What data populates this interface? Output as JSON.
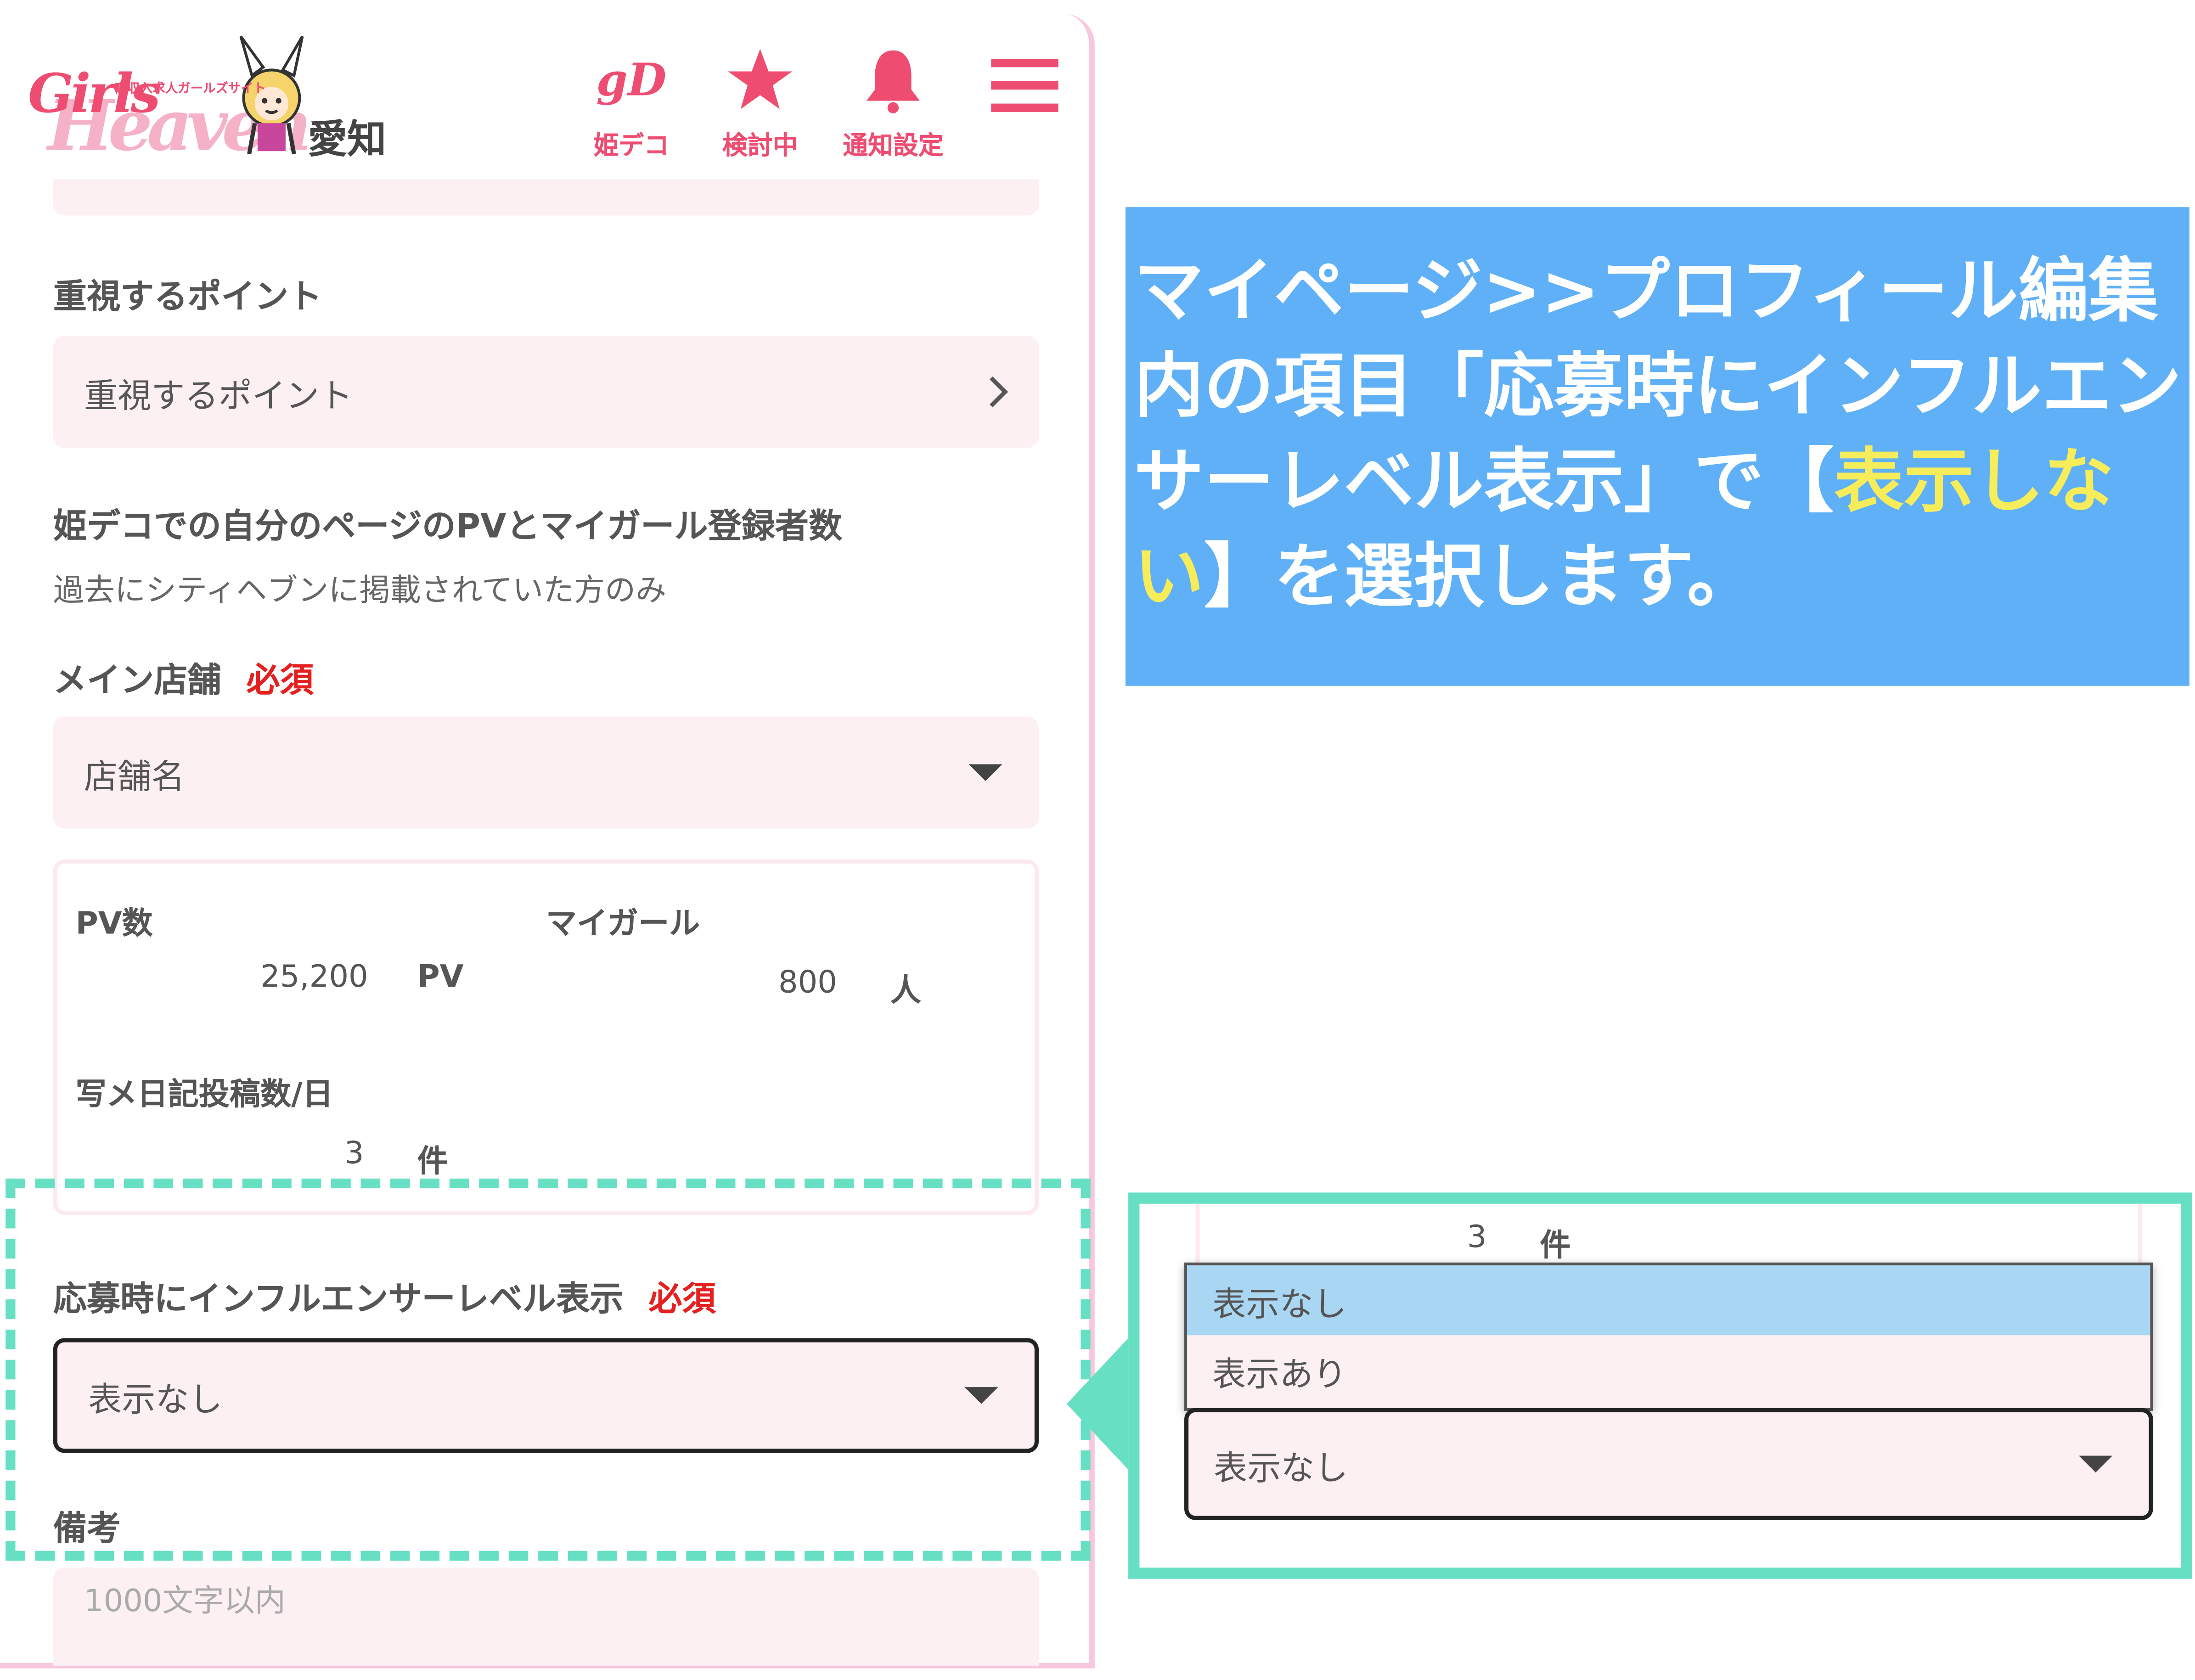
{
  "header": {
    "logo_girls": "Girls",
    "logo_heaven": "Heaven",
    "logo_tagline": "高収入求人ガールズサイト",
    "logo_area": "愛知",
    "nav": [
      {
        "label": "姫デコ",
        "icon": "himedeco-icon"
      },
      {
        "label": "検討中",
        "icon": "star-icon"
      },
      {
        "label": "通知設定",
        "icon": "bell-icon"
      }
    ],
    "menu_icon": "hamburger-icon"
  },
  "form": {
    "priority_label": "重視するポイント",
    "priority_placeholder": "重視するポイント",
    "pv_label": "姫デコでの自分のページのPVとマイガール登録者数",
    "pv_note": "過去にシティヘブンに掲載されていた方のみ",
    "main_store_label": "メイン店舗",
    "required": "必須",
    "store_placeholder": "店舗名",
    "stats": {
      "pv_label": "PV数",
      "pv_value": "25,200",
      "pv_unit": "PV",
      "mygirl_label": "マイガール",
      "mygirl_value": "800",
      "mygirl_unit": "人",
      "diary_label": "写メ日記投稿数/日",
      "diary_value": "3",
      "diary_unit": "件"
    },
    "influencer_label": "応募時にインフルエンサーレベル表示",
    "influencer_selected": "表示なし",
    "remarks_label": "備考",
    "remarks_placeholder": "1000文字以内"
  },
  "callout": {
    "text_before": "マイページ>>プロフィール編集内の項目「応募時にインフルエンサーレベル表示」で【",
    "highlight": "表示しない",
    "text_after": "】を選択します。"
  },
  "zoom": {
    "diary_value": "3",
    "diary_unit": "件",
    "options": [
      "表示なし",
      "表示あり"
    ],
    "selected": "表示なし"
  },
  "colors": {
    "brand_pink": "#ef4c72",
    "input_bg": "#fdf0f3",
    "callout_bg": "#5fb0f7",
    "callout_highlight": "#f7ed5a",
    "guide_teal": "#66dfc3",
    "required_red": "#e52020",
    "option_selected": "#a9d6f2"
  }
}
